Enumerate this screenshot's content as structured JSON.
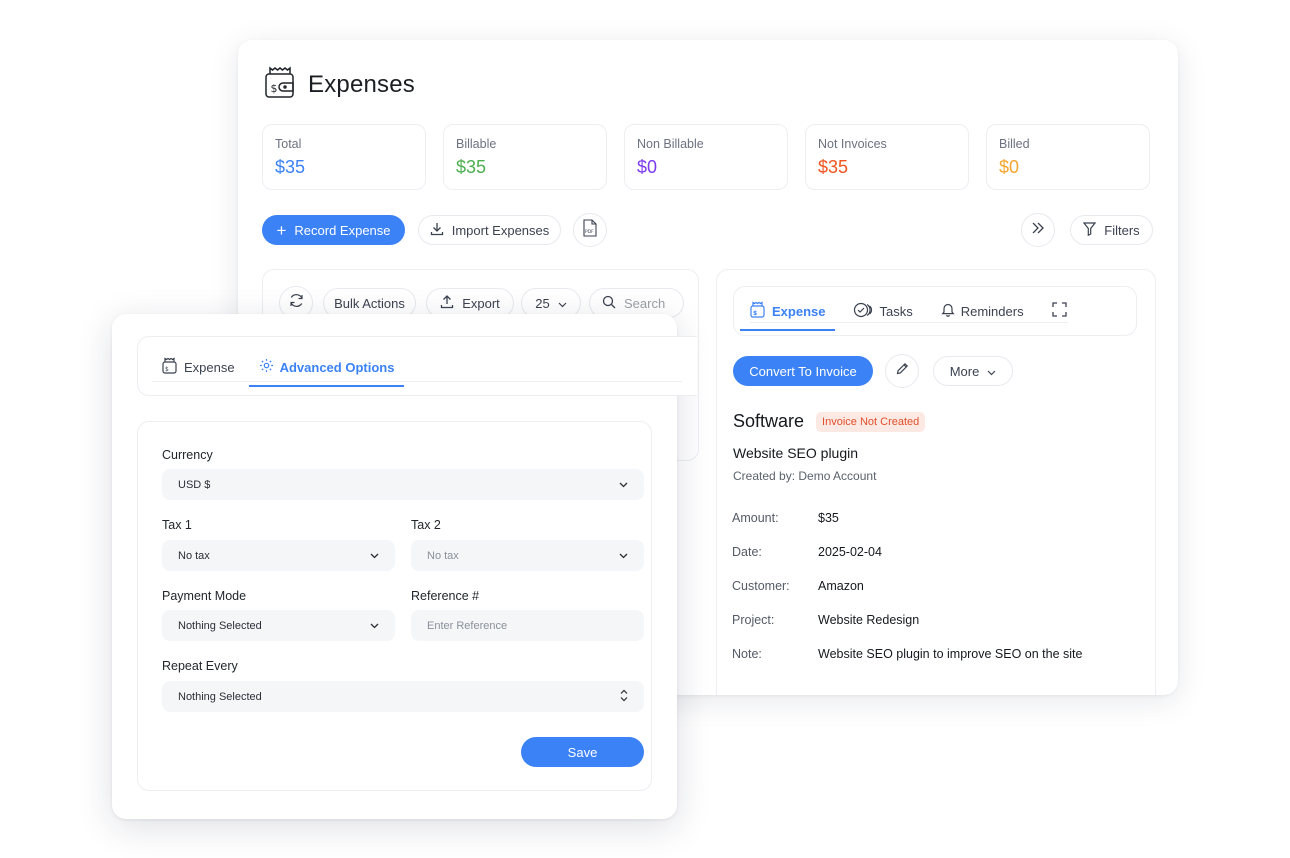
{
  "header": {
    "title": "Expenses",
    "icon": "wallet-dollar-icon"
  },
  "stats": [
    {
      "label": "Total",
      "value": "$35",
      "color": "#3b82f6"
    },
    {
      "label": "Billable",
      "value": "$35",
      "color": "#4caf50"
    },
    {
      "label": "Non Billable",
      "value": "$0",
      "color": "#7c3aed"
    },
    {
      "label": "Not Invoices",
      "value": "$35",
      "color": "#f0541e"
    },
    {
      "label": "Billed",
      "value": "$0",
      "color": "#f6a531"
    }
  ],
  "toolbar": {
    "record_label": "Record Expense",
    "import_label": "Import Expenses",
    "filters_label": "Filters"
  },
  "list_toolbar": {
    "bulk_label": "Bulk Actions",
    "export_label": "Export",
    "page_size": "25",
    "search_placeholder": "Search"
  },
  "detail": {
    "tabs": {
      "expense": "Expense",
      "tasks": "Tasks",
      "reminders": "Reminders"
    },
    "convert_label": "Convert To Invoice",
    "more_label": "More",
    "name": "Software",
    "status": "Invoice Not Created",
    "subtitle": "Website SEO plugin",
    "created_by": "Created by: Demo Account",
    "rows": [
      {
        "key": "Amount:",
        "value": "$35"
      },
      {
        "key": "Date:",
        "value": "2025-02-04"
      },
      {
        "key": "Customer:",
        "value": "Amazon"
      },
      {
        "key": "Project:",
        "value": "Website Redesign"
      },
      {
        "key": "Note:",
        "value": "Website SEO plugin to improve SEO on the site"
      }
    ]
  },
  "popup": {
    "tabs": {
      "expense": "Expense",
      "advanced": "Advanced Options"
    },
    "currency_label": "Currency",
    "currency_value": "USD $",
    "tax1_label": "Tax 1",
    "tax1_value": "No tax",
    "tax2_label": "Tax 2",
    "tax2_value": "No tax",
    "payment_label": "Payment Mode",
    "payment_value": "Nothing Selected",
    "reference_label": "Reference #",
    "reference_placeholder": "Enter Reference",
    "repeat_label": "Repeat Every",
    "repeat_value": "Nothing Selected",
    "save_label": "Save"
  },
  "colors": {
    "accent": "#3b82f6"
  }
}
